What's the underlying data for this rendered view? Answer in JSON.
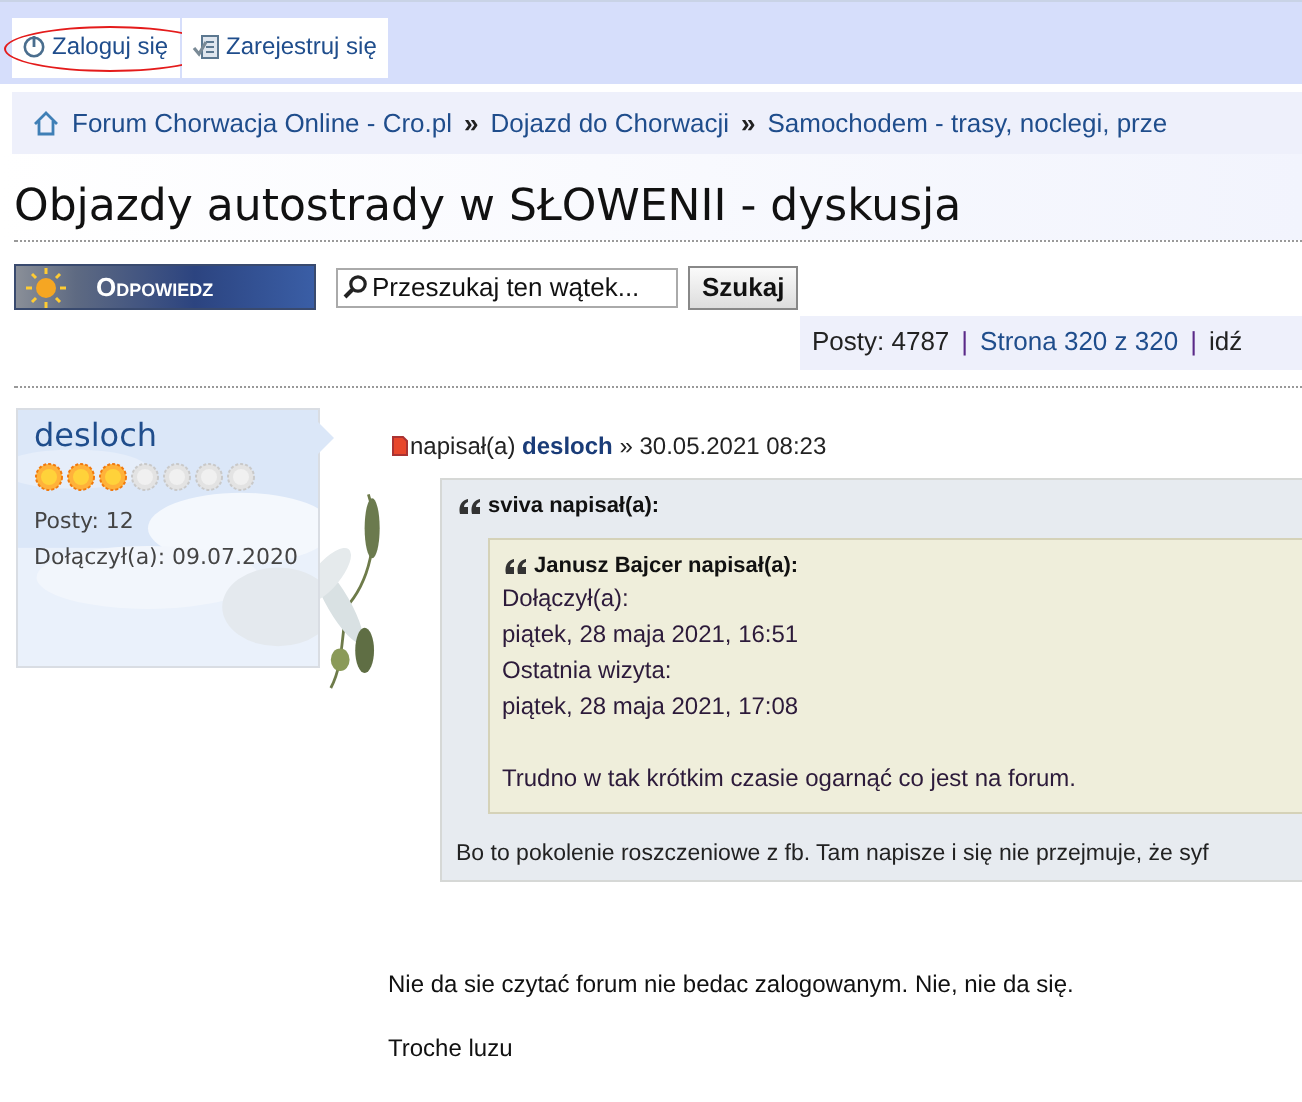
{
  "top_tabs": [
    {
      "label": "Zaloguj się",
      "circled": true
    },
    {
      "label": "Zarejestruj się",
      "circled": false
    }
  ],
  "breadcrumb": {
    "items": [
      "Forum Chorwacja Online - Cro.pl",
      "Dojazd do Chorwacji",
      "Samochodem - trasy, noclegi, prze"
    ],
    "separator": "»"
  },
  "topic_title": "Objazdy autostrady w SŁOWENII - dyskusja",
  "reply_button": "Odpowiedz",
  "search": {
    "placeholder": "Przeszukaj ten wątek...",
    "button": "Szukaj"
  },
  "pagination": {
    "posts": "Posty: 4787",
    "separator": "|",
    "page": "Strona 320 z 320",
    "jump": "idź"
  },
  "post": {
    "author": {
      "name": "desloch",
      "stars": 3,
      "posts": "Posty: 12",
      "joined": "Dołączył(a): 09.07.2020"
    },
    "header": {
      "prefix": "napisał(a)",
      "author": "desloch",
      "date": "» 30.05.2021 08:23"
    },
    "quote": {
      "title": "sviva napisał(a):",
      "inner": {
        "title": "Janusz Bajcer napisał(a):",
        "lines": [
          "Dołączył(a):",
          "piątek, 28 maja 2021, 16:51",
          "Ostatnia wizyta:",
          "piątek, 28 maja 2021, 17:08"
        ],
        "text": "Trudno w tak krótkim czasie ogarnąć co jest na forum."
      },
      "text": "Bo to pokolenie roszczeniowe z fb. Tam napisze i się nie przejmuje, że syf"
    },
    "paragraphs": [
      "Nie da sie czytać forum nie bedac zalogowanym. Nie, nie da się.",
      "Troche luzu"
    ]
  }
}
